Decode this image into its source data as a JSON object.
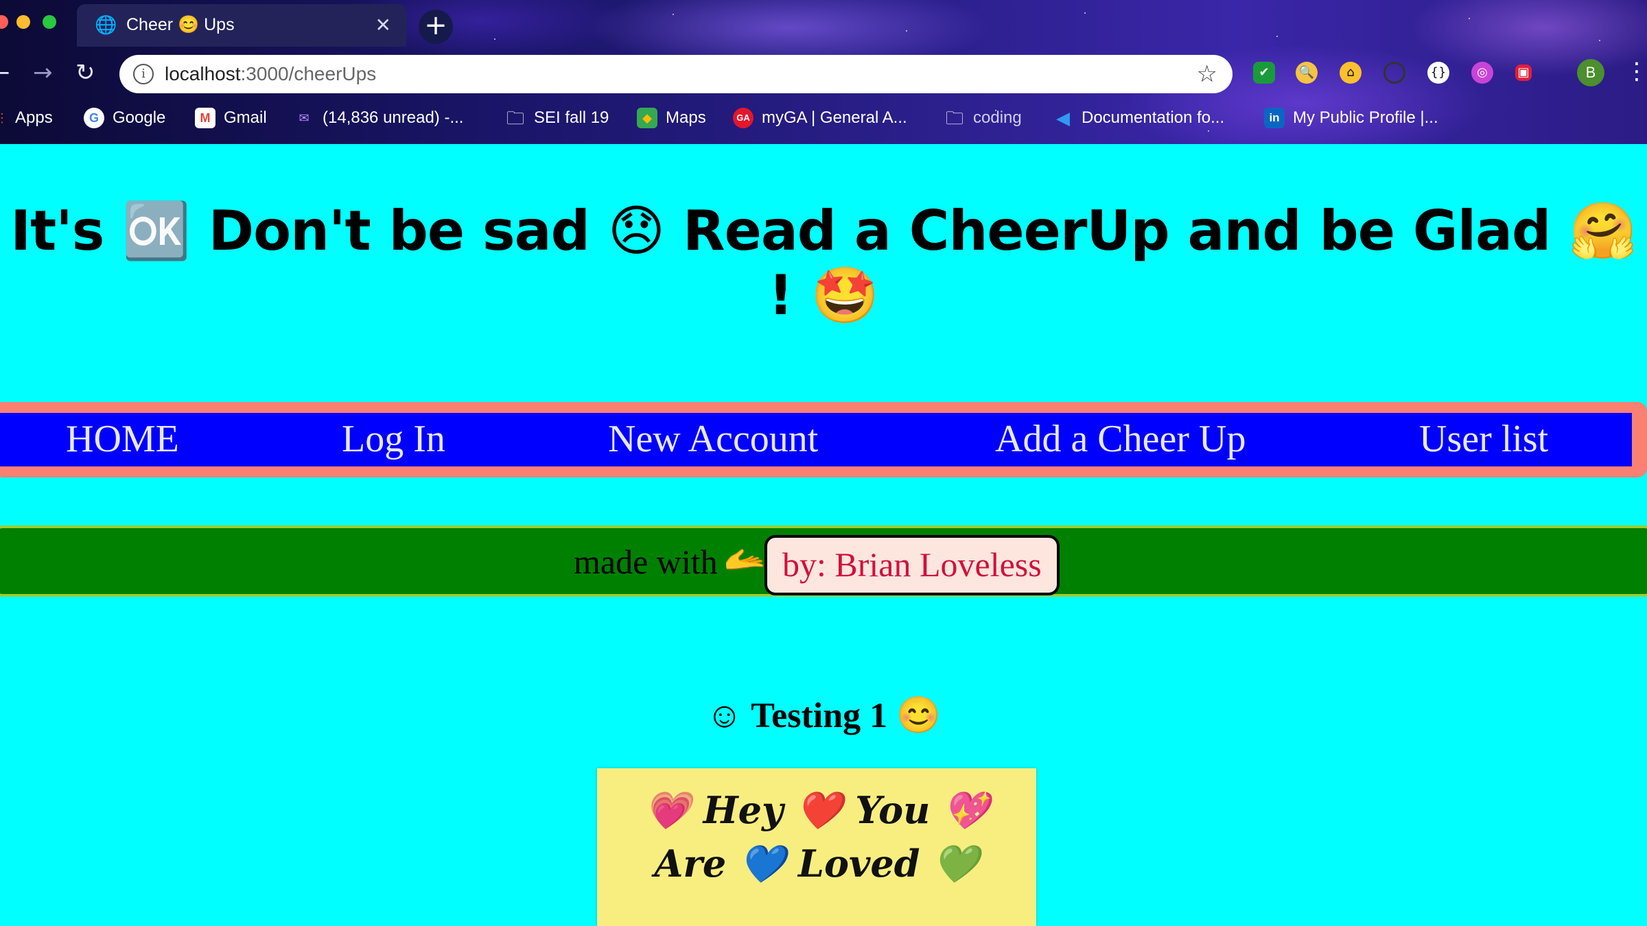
{
  "browser": {
    "tab_title": "Cheer 😊 Ups",
    "tab_close": "✕",
    "new_tab": "+",
    "url_host": "localhost",
    "url_path": ":3000/cheerUps",
    "profile_initial": "B",
    "bookmarks": [
      {
        "label": "Apps",
        "icon": "apps-grid-icon",
        "glyph": "⋮⋮",
        "color": "#ea4335"
      },
      {
        "label": "Google",
        "icon": "google-icon",
        "glyph": "G",
        "color": "#ffffff"
      },
      {
        "label": "Gmail",
        "icon": "gmail-icon",
        "glyph": "M",
        "color": "#ffffff"
      },
      {
        "label": "(14,836 unread) -...",
        "icon": "yahoo-mail-icon",
        "glyph": "✉",
        "color": "#6e2bd9"
      },
      {
        "label": "SEI fall 19",
        "icon": "folder-icon",
        "glyph": "▭",
        "color": "transparent"
      },
      {
        "label": "Maps",
        "icon": "maps-icon",
        "glyph": "◆",
        "color": "#34a853"
      },
      {
        "label": "myGA | General A...",
        "icon": "ga-icon",
        "glyph": "GA",
        "color": "#e3162d"
      },
      {
        "label": "coding",
        "icon": "folder-icon",
        "glyph": "▭",
        "color": "transparent"
      },
      {
        "label": "Documentation fo...",
        "icon": "vscode-icon",
        "glyph": "◀",
        "color": "transparent"
      },
      {
        "label": "My Public Profile |...",
        "icon": "linkedin-icon",
        "glyph": "in",
        "color": "#0a66c2"
      }
    ]
  },
  "page": {
    "headline": "It's 🆗 Don't be sad 😞 Read a CheerUp and be Glad 🤗 ! 🤩",
    "nav": [
      {
        "label": "HOME"
      },
      {
        "label": "Log In"
      },
      {
        "label": "New Account"
      },
      {
        "label": "Add a Cheer Up"
      },
      {
        "label": "User list"
      }
    ],
    "footer": {
      "made_with": "made with",
      "heart_hand": "🫴",
      "author": "by: Brian Loveless"
    },
    "cheer": {
      "title": "☺ Testing 1 😊",
      "text": "💗 Hey ❤️ You 💖 Are 💙 Loved 💚"
    }
  },
  "colors": {
    "page_bg": "#00ffff",
    "nav_bg": "#0000ff",
    "nav_border": "#fa8072",
    "footer_bg": "#008000",
    "footer_border": "#9acd32",
    "author_text": "#d1103c",
    "card_bg": "#f8ee80"
  }
}
